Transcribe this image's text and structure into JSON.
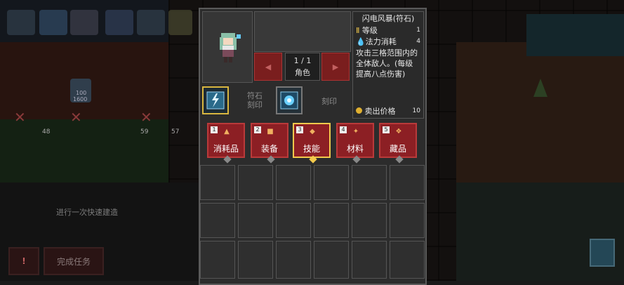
{
  "hud": {
    "quick_build": "进行一次快速建造",
    "alert_label": "!",
    "finish_task": "完成任务",
    "numbers": [
      "100",
      "1600",
      "48",
      "59",
      "57"
    ]
  },
  "inventory": {
    "page": "1 / 1",
    "page_label": "角色",
    "prev_icon": "left-arrow-icon",
    "next_icon": "right-arrow-icon",
    "slot_rune_label_1": "符石",
    "slot_rune_label_2": "刻印",
    "slot_seal_label": "刻印",
    "item": {
      "name": "闪电风暴(符石)",
      "level_label": "等级",
      "level_value": "1",
      "mana_label": "法力消耗",
      "mana_value": "4",
      "description": "攻击三格范围内的全体敌人。(每级提高八点伤害)",
      "sell_label": "卖出价格",
      "sell_value": "10"
    },
    "tabs": [
      {
        "num": "1",
        "label": "消耗品",
        "icon": "potion-icon"
      },
      {
        "num": "2",
        "label": "装备",
        "icon": "armor-icon"
      },
      {
        "num": "3",
        "label": "技能",
        "icon": "skill-icon"
      },
      {
        "num": "4",
        "label": "材料",
        "icon": "material-icon"
      },
      {
        "num": "5",
        "label": "藏品",
        "icon": "collectible-icon"
      }
    ]
  },
  "colors": {
    "tab_red": "#8c1f24",
    "tab_active_border": "#f2c94c",
    "panel_bg": "#2c2c2c"
  }
}
